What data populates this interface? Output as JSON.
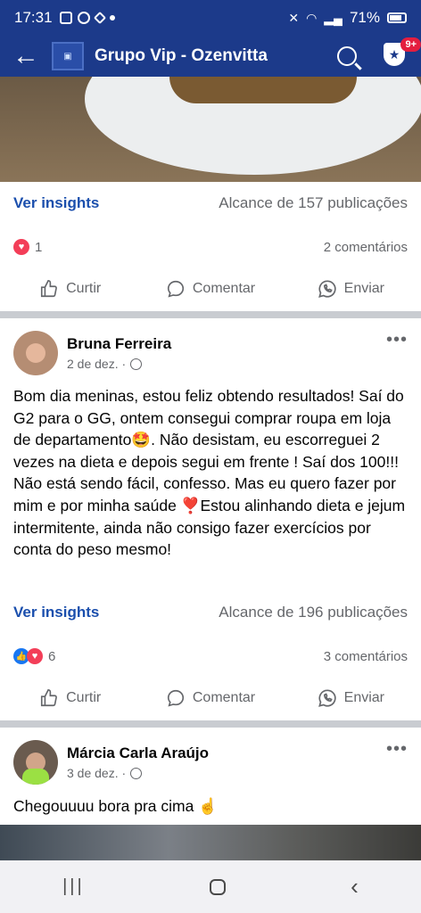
{
  "status_bar": {
    "time": "17:31",
    "battery": "71%"
  },
  "app_bar": {
    "title": "Grupo Vip - Ozenvitta",
    "notification_badge": "9+"
  },
  "post1": {
    "insights_label": "Ver insights",
    "reach": "Alcance de 157 publicações",
    "reaction_count": "1",
    "comments": "2 comentários",
    "actions": {
      "like": "Curtir",
      "comment": "Comentar",
      "send": "Enviar"
    }
  },
  "post2": {
    "author": "Bruna Ferreira",
    "date": "2 de dez. ·",
    "text": "Bom dia meninas, estou feliz obtendo resultados! Saí do G2 para o GG, ontem consegui comprar roupa em loja de departamento🤩. Não desistam, eu escorreguei 2 vezes na dieta e depois segui em frente ! Saí dos 100!!! Não está sendo fácil, confesso. Mas eu quero fazer por mim e por minha saúde ❣️Estou alinhando dieta e jejum intermitente, ainda não consigo fazer exercícios por conta do peso mesmo!",
    "insights_label": "Ver insights",
    "reach": "Alcance de 196 publicações",
    "reaction_count": "6",
    "comments": "3 comentários",
    "actions": {
      "like": "Curtir",
      "comment": "Comentar",
      "send": "Enviar"
    }
  },
  "post3": {
    "author": "Márcia Carla Araújo",
    "date": "3 de dez. ·",
    "text": "Chegouuuu bora pra cima ☝️"
  },
  "colors": {
    "header": "#1c3a8a",
    "link": "#1b4fad",
    "secondary_text": "#65676b"
  }
}
